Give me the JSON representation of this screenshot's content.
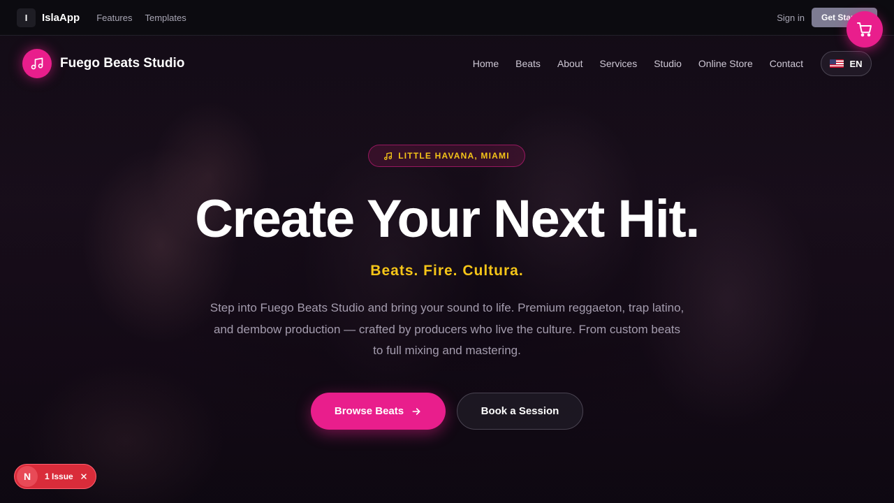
{
  "platform": {
    "logo_letter": "I",
    "brand": "IslaApp",
    "nav": [
      "Features",
      "Templates"
    ],
    "signin": "Sign in",
    "get_started": "Get Started"
  },
  "site": {
    "name": "Fuego Beats Studio",
    "nav": [
      "Home",
      "Beats",
      "About",
      "Services",
      "Studio",
      "Online Store",
      "Contact"
    ],
    "language": "EN"
  },
  "hero": {
    "badge": "LITTLE HAVANA, MIAMI",
    "title": "Create Your Next Hit.",
    "tagline": "Beats. Fire. Cultura.",
    "description": "Step into Fuego Beats Studio and bring your sound to life. Premium reggaeton, trap latino, and dembow production — crafted by producers who live the culture. From custom beats to full mixing and mastering.",
    "primary_cta": "Browse Beats",
    "secondary_cta": "Book a Session"
  },
  "dev_overlay": {
    "letter": "N",
    "issues": "1 Issue"
  },
  "colors": {
    "accent": "#e91e8c",
    "highlight": "#f5c518",
    "background": "#0d0812"
  }
}
